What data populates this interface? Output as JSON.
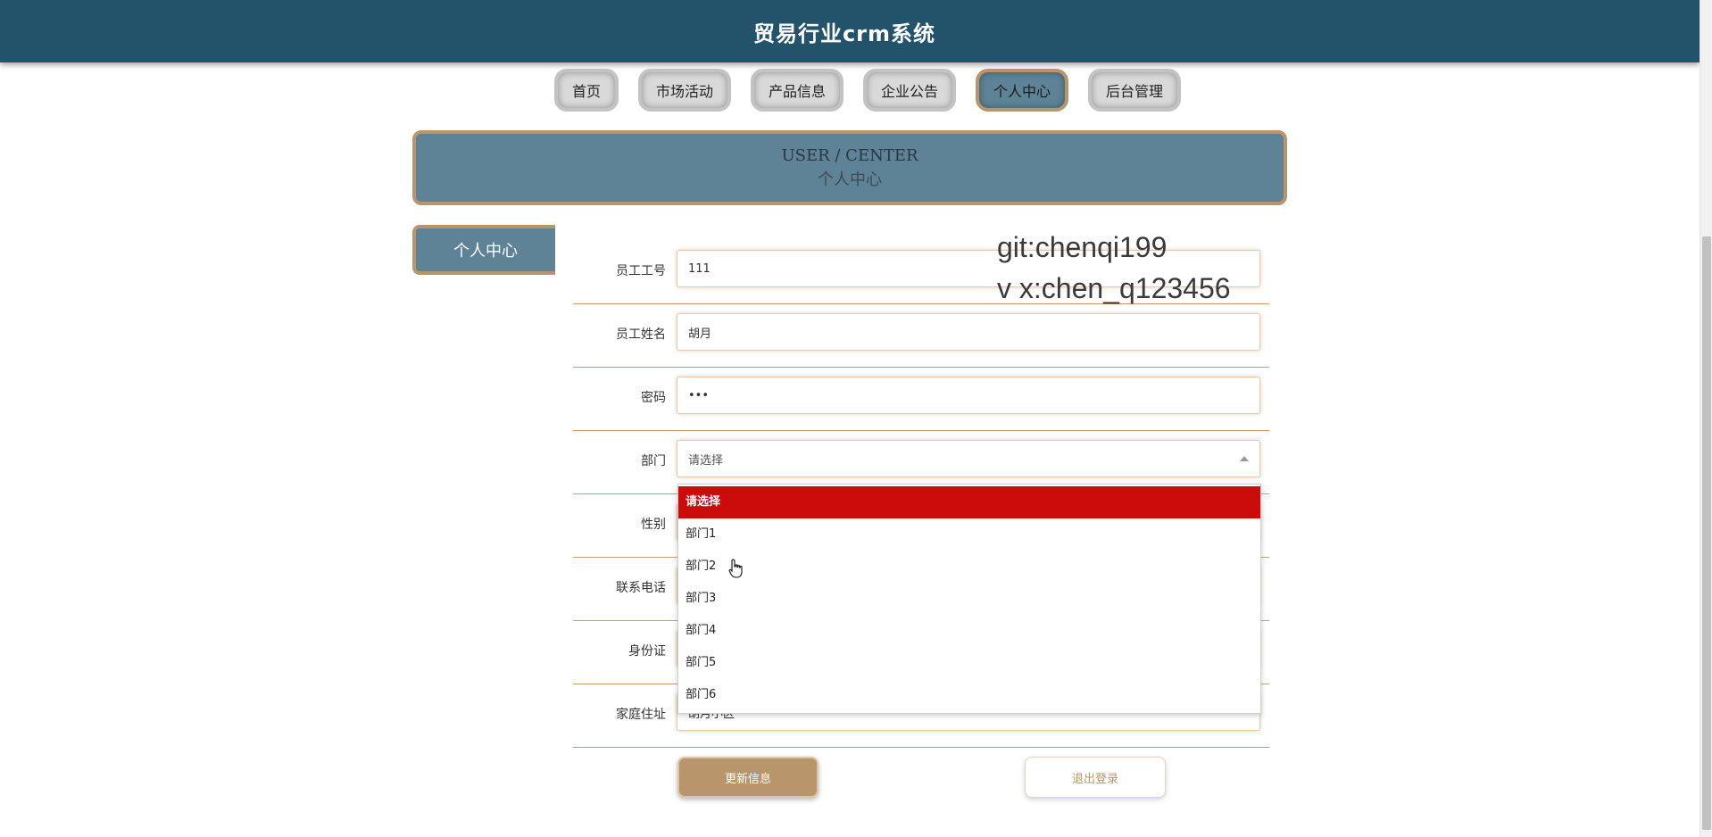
{
  "header": {
    "title": "贸易行业crm系统"
  },
  "nav": [
    {
      "label": "首页",
      "active": false
    },
    {
      "label": "市场活动",
      "active": false
    },
    {
      "label": "产品信息",
      "active": false
    },
    {
      "label": "企业公告",
      "active": false
    },
    {
      "label": "个人中心",
      "active": true
    },
    {
      "label": "后台管理",
      "active": false
    }
  ],
  "banner": {
    "en": "USER / CENTER",
    "cn": "个人中心"
  },
  "side_menu": {
    "item": "个人中心"
  },
  "form": {
    "employee_id": {
      "label": "员工工号",
      "value": "111"
    },
    "employee_name": {
      "label": "员工姓名",
      "value": "胡月"
    },
    "password": {
      "label": "密码",
      "value": "•••"
    },
    "department": {
      "label": "部门",
      "value": "请选择"
    },
    "gender": {
      "label": "性别"
    },
    "phone": {
      "label": "联系电话"
    },
    "id_card": {
      "label": "身份证"
    },
    "address": {
      "label": "家庭住址",
      "value": "胡月小区"
    }
  },
  "dropdown": {
    "options": [
      "请选择",
      "部门1",
      "部门2",
      "部门3",
      "部门4",
      "部门5",
      "部门6"
    ],
    "selected_index": 0
  },
  "buttons": {
    "update": "更新信息",
    "logout": "退出登录"
  },
  "watermark": {
    "line1": "git:chenqi199",
    "line2": "v x:chen_q123456"
  },
  "colors": {
    "header_bg": "#22536b",
    "accent": "#b8956a",
    "panel": "#5e8396",
    "dropdown_selected": "#cc0b0b"
  }
}
